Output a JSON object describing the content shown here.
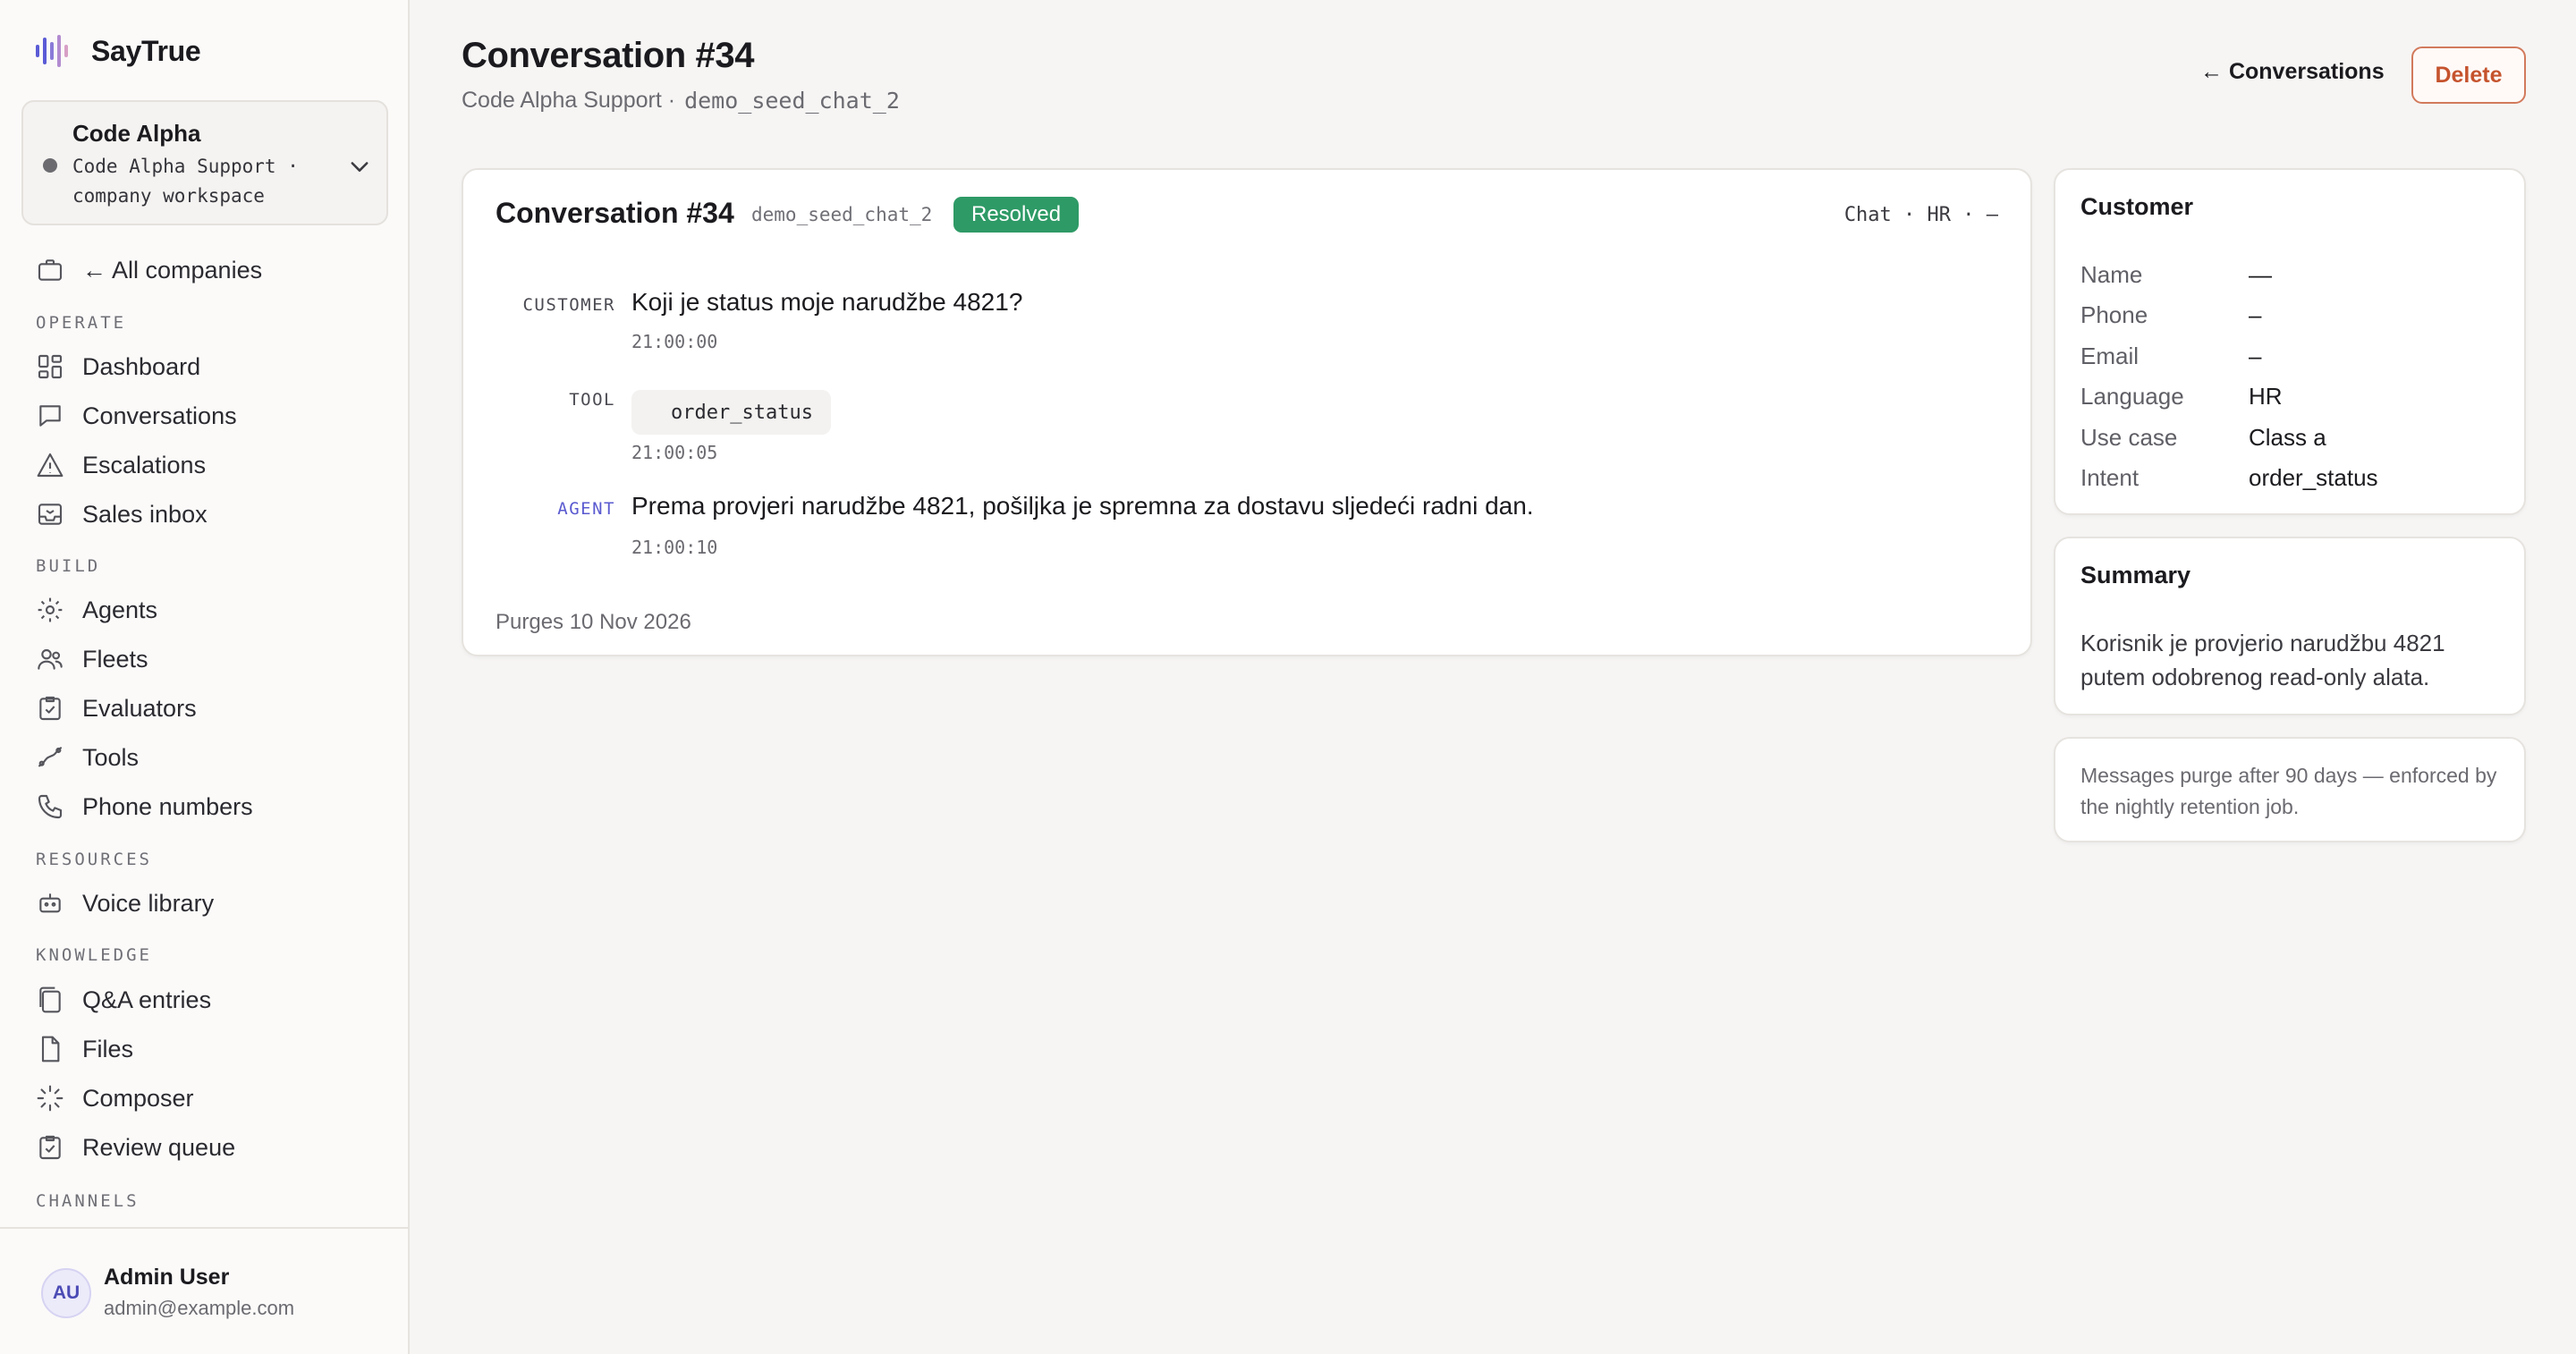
{
  "brand": {
    "name": "SayTrue",
    "accent": "#5b5bd6"
  },
  "workspace": {
    "name": "Code Alpha",
    "subtitle": "Code Alpha Support · company workspace"
  },
  "sidebar": {
    "all_companies": "← All companies",
    "sections": {
      "operate": "OPERATE",
      "build": "BUILD",
      "resources": "RESOURCES",
      "knowledge": "KNOWLEDGE",
      "channels": "CHANNELS"
    },
    "items": [
      {
        "label": "Dashboard",
        "icon": "dashboard-icon"
      },
      {
        "label": "Conversations",
        "icon": "chat-bubble-icon"
      },
      {
        "label": "Escalations",
        "icon": "warning-triangle-icon"
      },
      {
        "label": "Sales inbox",
        "icon": "inbox-icon"
      },
      {
        "label": "Agents",
        "icon": "gear-icon"
      },
      {
        "label": "Fleets",
        "icon": "users-icon"
      },
      {
        "label": "Evaluators",
        "icon": "clipboard-check-icon"
      },
      {
        "label": "Tools",
        "icon": "tool-icon"
      },
      {
        "label": "Phone numbers",
        "icon": "phone-icon"
      },
      {
        "label": "Voice library",
        "icon": "robot-icon"
      },
      {
        "label": "Q&A entries",
        "icon": "copy-icon"
      },
      {
        "label": "Files",
        "icon": "file-icon"
      },
      {
        "label": "Composer",
        "icon": "sparkle-loader-icon"
      },
      {
        "label": "Review queue",
        "icon": "clipboard-check-icon"
      }
    ],
    "user": {
      "initials": "AU",
      "name": "Admin User",
      "email": "admin@example.com"
    }
  },
  "header": {
    "title": "Conversation #34",
    "subtitle_company": "Code Alpha Support ·",
    "subtitle_slug": "demo_seed_chat_2",
    "back_label": "← Conversations",
    "delete_label": "Delete"
  },
  "conversation": {
    "title": "Conversation #34",
    "slug": "demo_seed_chat_2",
    "status": "Resolved",
    "status_color": "#2e9a66",
    "meta": "Chat · HR · –",
    "messages": [
      {
        "role": "CUSTOMER",
        "text": "Koji je status moje narudžbe 4821?",
        "time": "21:00:00"
      },
      {
        "role": "TOOL",
        "text": "order_status",
        "time": "21:00:05"
      },
      {
        "role": "AGENT",
        "text": "Prema provjeri narudžbe 4821, pošiljka je spremna za dostavu sljedeći radni dan.",
        "time": "21:00:10"
      }
    ],
    "purge_note": "Purges 10 Nov 2026"
  },
  "customer": {
    "title": "Customer",
    "fields": [
      {
        "key": "Name",
        "value": "—"
      },
      {
        "key": "Phone",
        "value": "–"
      },
      {
        "key": "Email",
        "value": "–"
      },
      {
        "key": "Language",
        "value": "HR"
      },
      {
        "key": "Use case",
        "value": "Class a"
      },
      {
        "key": "Intent",
        "value": "order_status"
      }
    ]
  },
  "summary": {
    "title": "Summary",
    "text": "Korisnik je provjerio narudžbu 4821 putem odobrenog read-only alata."
  },
  "retention_note": "Messages purge after 90 days — enforced by the nightly retention job."
}
